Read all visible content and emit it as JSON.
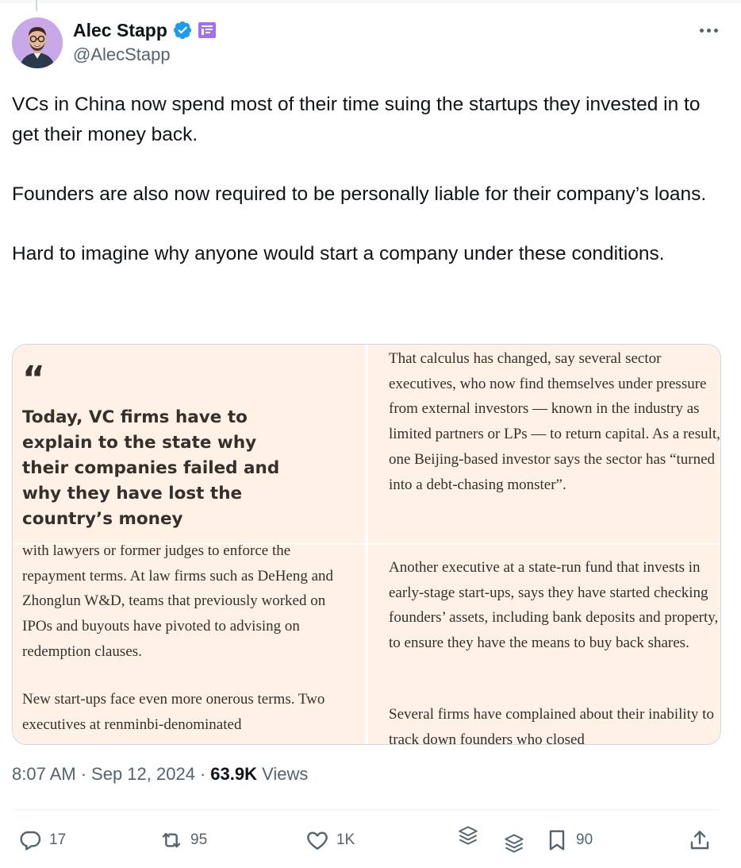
{
  "author": {
    "display_name": "Alec Stapp",
    "handle": "@AlecStapp"
  },
  "tweet": {
    "paragraphs": [
      "VCs in China now spend most of their time suing the startups they invested in to get their money back.",
      "Founders are also now required to be personally liable for their company’s loans.",
      "Hard to imagine why anyone would start a company under these conditions."
    ]
  },
  "media": {
    "top_left": {
      "quote_mark": "“",
      "pull_quote": "Today, VC firms have to explain to the state why their companies failed and why they have lost the country’s money"
    },
    "top_right": {
      "text": "That calculus has changed, say several sector executives, who now find themselves under pressure from external investors — known in the industry as limited partners or LPs — to return capital. As a result, one Beijing-based investor says the sector has “turned into a debt-chasing monster”."
    },
    "bottom_left": {
      "paragraph_1": "with lawyers or former judges to enforce the repayment terms. At law firms such as DeHeng and Zhonglun W&D, teams that previously worked on IPOs and buyouts have pivoted to advising on redemption clauses.",
      "paragraph_2": "New start-ups face even more onerous terms. Two executives at renminbi-denominated"
    },
    "bottom_right": {
      "paragraph_1": "Another executive at a state-run fund that invests in early-stage start-ups, says they have started checking founders’ assets, including bank deposits and property, to ensure they have the means to buy back shares.",
      "paragraph_2": "Several firms have complained about their inability to track down founders who closed"
    }
  },
  "meta": {
    "time": "8:07 AM",
    "separator": "·",
    "date": "Sep 12, 2024",
    "views_count": "63.9K",
    "views_label": "Views"
  },
  "actions": {
    "replies": "17",
    "reposts": "95",
    "likes": "1K",
    "bookmarks": "90"
  },
  "colors": {
    "text": "#0f1419",
    "secondary": "#536471",
    "verified": "#1d9bf0",
    "affiliate": "#a36ff0",
    "ft_background": "#fff1e5"
  }
}
